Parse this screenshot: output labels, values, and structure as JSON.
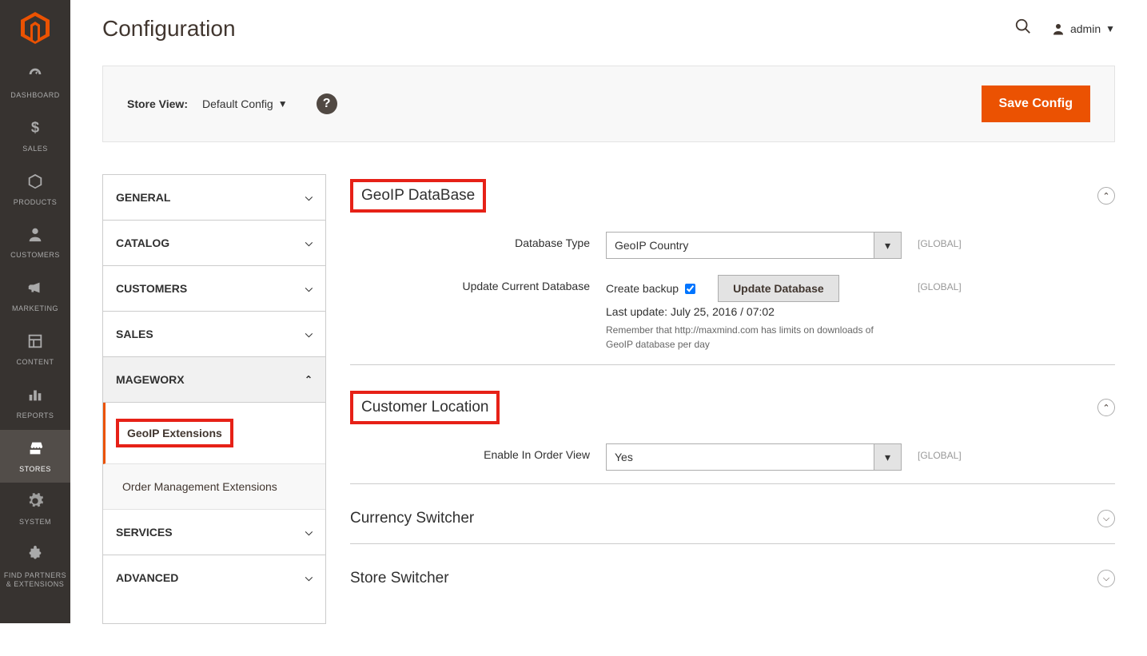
{
  "page": {
    "title": "Configuration"
  },
  "header": {
    "admin_label": "admin"
  },
  "storeBar": {
    "label": "Store View:",
    "value": "Default Config",
    "saveButton": "Save Config"
  },
  "sidebar": {
    "items": [
      {
        "label": "DASHBOARD"
      },
      {
        "label": "SALES"
      },
      {
        "label": "PRODUCTS"
      },
      {
        "label": "CUSTOMERS"
      },
      {
        "label": "MARKETING"
      },
      {
        "label": "CONTENT"
      },
      {
        "label": "REPORTS"
      },
      {
        "label": "STORES"
      },
      {
        "label": "SYSTEM"
      },
      {
        "label": "FIND PARTNERS & EXTENSIONS"
      }
    ]
  },
  "configNav": {
    "general": "GENERAL",
    "catalog": "CATALOG",
    "customers": "CUSTOMERS",
    "sales": "SALES",
    "mageworx": "MAGEWORX",
    "geoip": "GeoIP Extensions",
    "orderMgmt": "Order Management Extensions",
    "services": "SERVICES",
    "advanced": "ADVANCED"
  },
  "sections": {
    "geoipDb": {
      "title": "GeoIP DataBase",
      "dbTypeLabel": "Database Type",
      "dbTypeValue": "GeoIP Country",
      "updateLabel": "Update Current Database",
      "backupLabel": "Create backup",
      "updateButton": "Update Database",
      "lastUpdate": "Last update: July 25, 2016 / 07:02",
      "note": "Remember that http://maxmind.com has limits on downloads of GeoIP database per day",
      "scope": "[GLOBAL]"
    },
    "customerLoc": {
      "title": "Customer Location",
      "enableLabel": "Enable In Order View",
      "enableValue": "Yes",
      "scope": "[GLOBAL]"
    },
    "currency": {
      "title": "Currency Switcher"
    },
    "store": {
      "title": "Store Switcher"
    }
  }
}
